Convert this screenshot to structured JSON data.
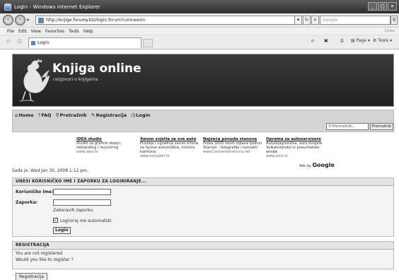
{
  "browser": {
    "window_title": "Login - Windows Internet Explorer",
    "address": "http://knjige.forumy.biz/login.forum?connexion",
    "search_placeholder": "Google",
    "menus": [
      "File",
      "Edit",
      "View",
      "Favorites",
      "Tools",
      "Help"
    ],
    "links_label": "Links",
    "tab_label": "Login",
    "cmd_page": "Page",
    "cmd_tools": "Tools"
  },
  "site": {
    "title": "Knjiga online",
    "subtitle": "razgovori o knjigama"
  },
  "nav": {
    "links": [
      {
        "icon": "⌂",
        "label": "Home"
      },
      {
        "icon": "?",
        "label": "FAQ"
      },
      {
        "icon": "⚲",
        "label": "Pretražnik"
      },
      {
        "icon": "✎",
        "label": "Registracija"
      },
      {
        "icon": "◷",
        "label": "Login"
      }
    ],
    "search_value": "Pretražnik...",
    "search_button": "Pretražnik"
  },
  "ads": [
    {
      "title": "iDEA studio",
      "desc": "Studio za grafički dizajn, rebranding i recoloring",
      "url": "www.idea.hr"
    },
    {
      "title": "Xenon svjetla za sve auto",
      "desc": "Prodaja i ugradnja xenon kitova za farove automobila, motora, kamiona",
      "url": "www.molydon.hr"
    },
    {
      "title": "Najveća ponuda stanova",
      "desc": "Preko 3000 novih oglasa tjedno! Stanovi - fotografije i kontakti",
      "url": "www.Centarnekretnina.net"
    },
    {
      "title": "Oprema za autoservisere",
      "desc": "Autodijagnostika, auto dvigala Vulkanizersko in pneumatsko orodje",
      "url": "www.koch.si"
    }
  ],
  "ads_by": {
    "prefix": "Ads by",
    "brand": "Google"
  },
  "now": "Sada je: Wed Jan 30, 2008 1:12 pm.",
  "login": {
    "header": "UNESI KORISNIČKO IME I ZAPORKU ZA LOGINIRANJE...",
    "username_label": "Korisničko ime:",
    "password_label": "Zaporka:",
    "forgot": "Zaboravih zaporku",
    "auto_label": "Loginiraj me automatski",
    "auto_checked": "✓",
    "submit": "Login"
  },
  "register": {
    "header": "REGISTRACIJA",
    "line1": "You are not registered",
    "line2": "Would you like to register ?",
    "button": "Registracija"
  }
}
